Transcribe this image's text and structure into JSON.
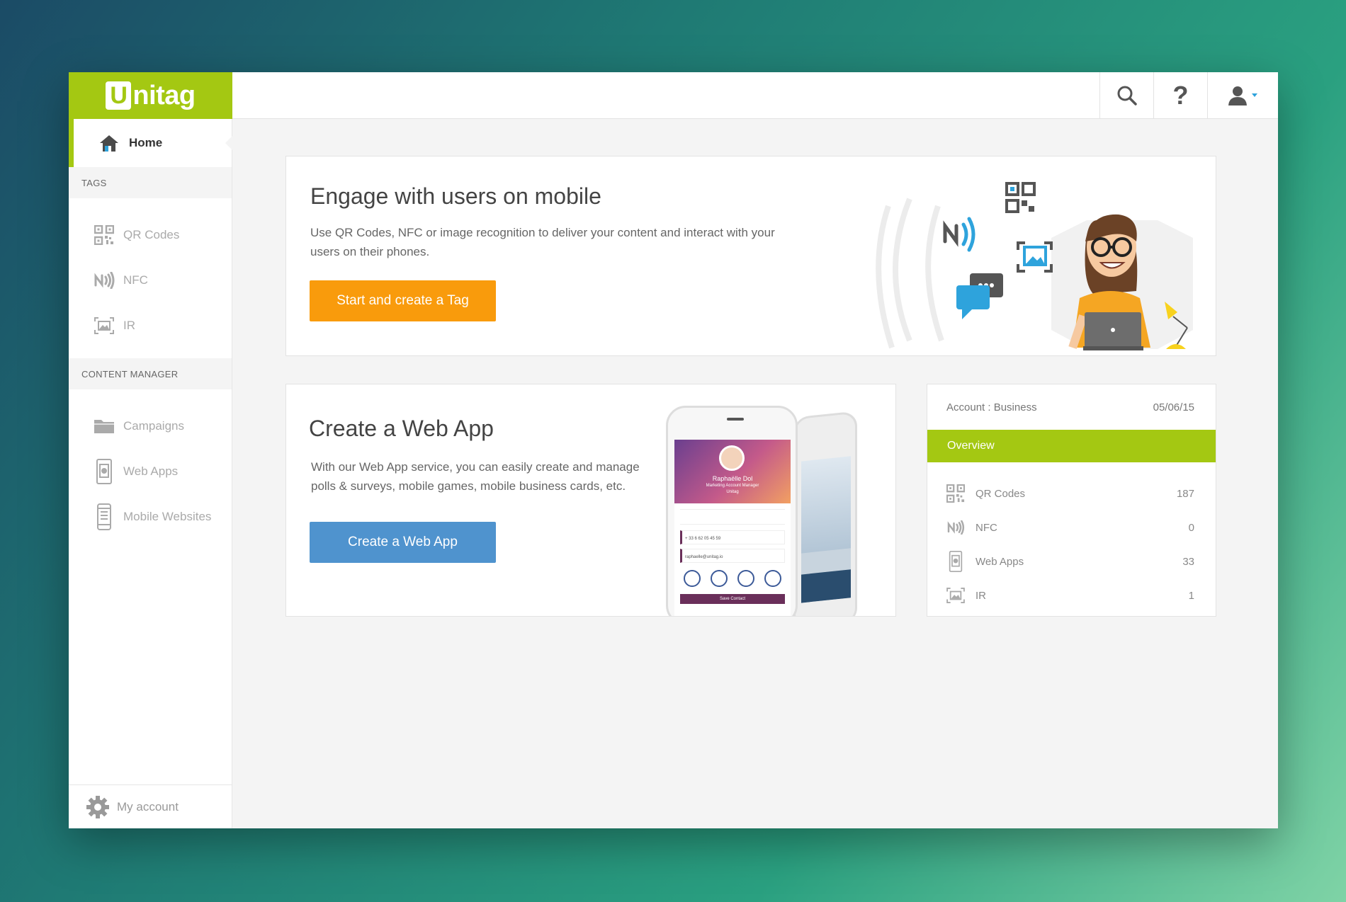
{
  "brand": {
    "logo_initial": "U",
    "logo_rest": "nitag"
  },
  "topbar": {
    "search": "search-icon",
    "help": "?",
    "user": "user-icon"
  },
  "sidebar": {
    "home": "Home",
    "tags_header": "TAGS",
    "tags": [
      {
        "label": "QR Codes",
        "icon": "qr-code-icon"
      },
      {
        "label": "NFC",
        "icon": "nfc-icon"
      },
      {
        "label": "IR",
        "icon": "image-recognition-icon"
      }
    ],
    "content_header": "CONTENT MANAGER",
    "content": [
      {
        "label": "Campaigns",
        "icon": "folder-icon"
      },
      {
        "label": "Web Apps",
        "icon": "web-app-icon"
      },
      {
        "label": "Mobile Websites",
        "icon": "mobile-icon"
      }
    ],
    "footer": "My account"
  },
  "engage": {
    "title": "Engage with users on mobile",
    "text": "Use QR Codes, NFC or image recognition to deliver your content and interact with your users on their phones.",
    "button": "Start and create a Tag"
  },
  "webapp": {
    "title": "Create a Web App",
    "text": "With our Web App service, you can easily create and manage polls & surveys, mobile games, mobile business cards, etc.",
    "button": "Create a Web App",
    "phone": {
      "name": "Raphaëlle Dol",
      "role": "Marketing Account Manager",
      "company": "Unitag",
      "phone": "+ 33 6 62 05 45 59",
      "email": "raphaelle@unitag.io",
      "save": "Save Contact"
    }
  },
  "account": {
    "label": "Account : Business",
    "date": "05/06/15",
    "tab": "Overview",
    "rows": [
      {
        "label": "QR Codes",
        "value": "187"
      },
      {
        "label": "NFC",
        "value": "0"
      },
      {
        "label": "Web Apps",
        "value": "33"
      },
      {
        "label": "IR",
        "value": "1"
      }
    ]
  },
  "colors": {
    "brand_green": "#a4c812",
    "orange": "#f99b0c",
    "blue": "#4f93ce"
  }
}
